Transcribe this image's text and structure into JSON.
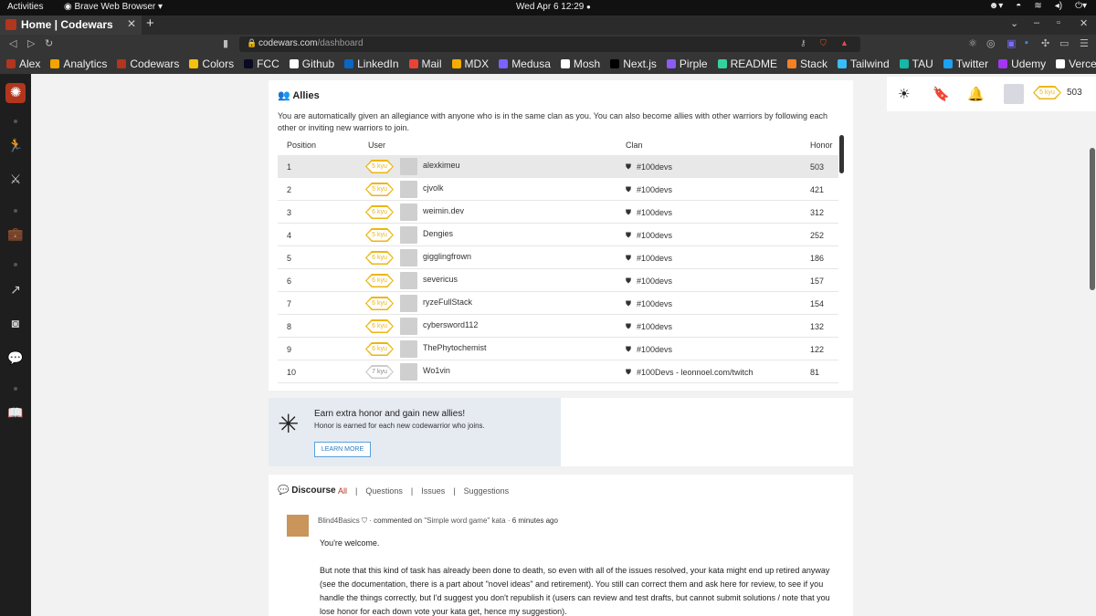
{
  "system": {
    "activities": "Activities",
    "browser": "Brave Web Browser",
    "clock": "Wed Apr 6  12:29"
  },
  "tab": {
    "title": "Home | Codewars"
  },
  "address": {
    "host": "codewars.com",
    "path": "/dashboard"
  },
  "bookmarks": [
    {
      "label": "Alex",
      "color": "#b1361e"
    },
    {
      "label": "Analytics",
      "color": "#f4a300"
    },
    {
      "label": "Codewars",
      "color": "#b1361e"
    },
    {
      "label": "Colors",
      "color": "#f4c20d"
    },
    {
      "label": "FCC",
      "color": "#0a0a23"
    },
    {
      "label": "Github",
      "color": "#ffffff"
    },
    {
      "label": "LinkedIn",
      "color": "#0a66c2"
    },
    {
      "label": "Mail",
      "color": "#ea4335"
    },
    {
      "label": "MDX",
      "color": "#f9ac00"
    },
    {
      "label": "Medusa",
      "color": "#7b61ff"
    },
    {
      "label": "Mosh",
      "color": "#ffffff"
    },
    {
      "label": "Next.js",
      "color": "#000000"
    },
    {
      "label": "Pirple",
      "color": "#8b5cf6"
    },
    {
      "label": "README",
      "color": "#34d399"
    },
    {
      "label": "Stack",
      "color": "#f48024"
    },
    {
      "label": "Tailwind",
      "color": "#38bdf8"
    },
    {
      "label": "TAU",
      "color": "#14b8a6"
    },
    {
      "label": "Twitter",
      "color": "#1da1f2"
    },
    {
      "label": "Udemy",
      "color": "#a435f0"
    },
    {
      "label": "Vercel",
      "color": "#ffffff"
    }
  ],
  "user_panel": {
    "rank": "5 kyu",
    "honor": "503"
  },
  "allies": {
    "title": "Allies",
    "description": "You are automatically given an allegiance with anyone who is in the same clan as you. You can also become allies with other warriors by following each other or inviting new warriors to join.",
    "headers": {
      "position": "Position",
      "user": "User",
      "clan": "Clan",
      "honor": "Honor"
    },
    "rows": [
      {
        "pos": "1",
        "rank": "5 kyu",
        "user": "alexkimeu",
        "clan": "#100devs",
        "honor": "503"
      },
      {
        "pos": "2",
        "rank": "5 kyu",
        "user": "cjvolk",
        "clan": "#100devs",
        "honor": "421"
      },
      {
        "pos": "3",
        "rank": "6 kyu",
        "user": "weimin.dev",
        "clan": "#100devs",
        "honor": "312"
      },
      {
        "pos": "4",
        "rank": "5 kyu",
        "user": "Dengies",
        "clan": "#100devs",
        "honor": "252"
      },
      {
        "pos": "5",
        "rank": "6 kyu",
        "user": "gigglingfrown",
        "clan": "#100devs",
        "honor": "186"
      },
      {
        "pos": "6",
        "rank": "6 kyu",
        "user": "severicus",
        "clan": "#100devs",
        "honor": "157"
      },
      {
        "pos": "7",
        "rank": "6 kyu",
        "user": "ryzeFullStack",
        "clan": "#100devs",
        "honor": "154"
      },
      {
        "pos": "8",
        "rank": "6 kyu",
        "user": "cybersword112",
        "clan": "#100devs",
        "honor": "132"
      },
      {
        "pos": "9",
        "rank": "6 kyu",
        "user": "ThePhytochemist",
        "clan": "#100devs",
        "honor": "122"
      },
      {
        "pos": "10",
        "rank": "7 kyu",
        "user": "Wo1vin",
        "clan": "#100Devs - leonnoel.com/twitch",
        "honor": "81"
      }
    ]
  },
  "promo": {
    "title": "Earn extra honor and gain new allies!",
    "subtitle": "Honor is earned for each new codewarrior who joins.",
    "button": "LEARN MORE"
  },
  "discourse": {
    "title": "Discourse",
    "tabs": [
      "All",
      "Questions",
      "Issues",
      "Suggestions"
    ],
    "comment": {
      "author": "Blind4Basics",
      "action": "commented on",
      "kata": "\"Simple word game\" kata",
      "time": "6 minutes ago",
      "p1": "You're welcome.",
      "p2": "But note that this kind of task has already been done to death, so even with all of the issues resolved, your kata might end up retired anyway (see the documentation, there is a part about \"novel ideas\" and retirement). You still can correct them and ask here for review, to see if you handle the things correctly, but I'd suggest you don't republish it (users can review and test drafts, but cannot submit solutions / note that you lose honor for each down vote your kata get, hence my suggestion)."
    }
  }
}
